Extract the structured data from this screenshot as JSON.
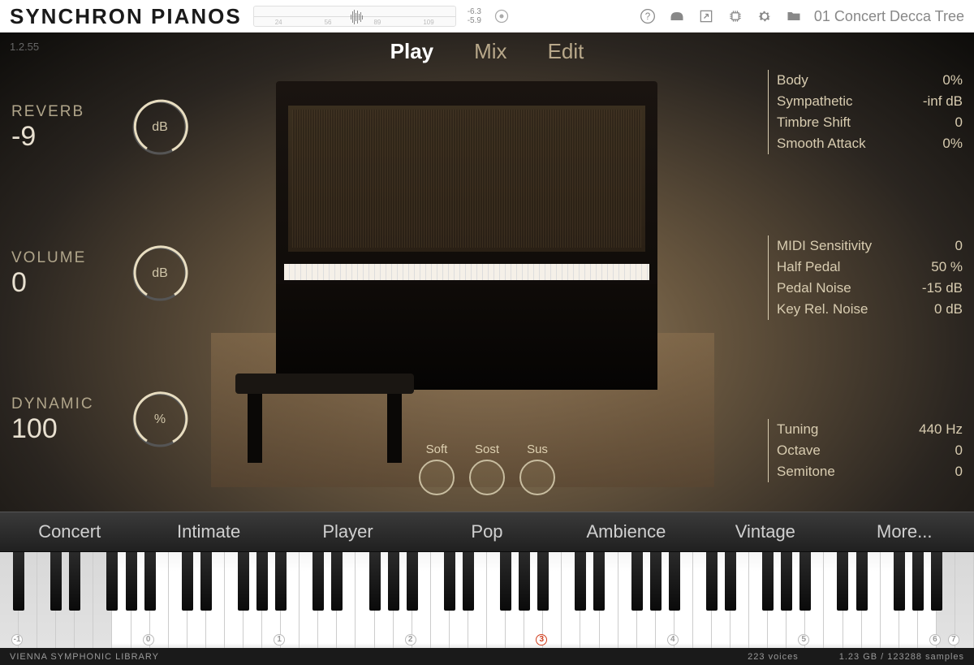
{
  "app_title": "SYNCHRON PIANOS",
  "version": "1.2.55",
  "meter": {
    "top": "-6.3",
    "bottom": "-5.9",
    "ticks": [
      "24",
      "56",
      "89",
      "109"
    ]
  },
  "preset": "01 Concert Decca Tree",
  "tabs": {
    "play": "Play",
    "mix": "Mix",
    "edit": "Edit"
  },
  "left": {
    "reverb": {
      "label": "REVERB",
      "value": "-9",
      "unit": "dB"
    },
    "volume": {
      "label": "VOLUME",
      "value": "0",
      "unit": "dB"
    },
    "dynamic": {
      "label": "DYNAMIC",
      "value": "100",
      "unit": "%"
    }
  },
  "right": {
    "g1": [
      {
        "label": "Body",
        "value": "0%"
      },
      {
        "label": "Sympathetic",
        "value": "-inf dB"
      },
      {
        "label": "Timbre Shift",
        "value": "0"
      },
      {
        "label": "Smooth Attack",
        "value": "0%"
      }
    ],
    "g2": [
      {
        "label": "MIDI Sensitivity",
        "value": "0"
      },
      {
        "label": "Half Pedal",
        "value": "50 %"
      },
      {
        "label": "Pedal Noise",
        "value": "-15 dB"
      },
      {
        "label": "Key Rel. Noise",
        "value": "0 dB"
      }
    ],
    "g3": [
      {
        "label": "Tuning",
        "value": "440 Hz"
      },
      {
        "label": "Octave",
        "value": "0"
      },
      {
        "label": "Semitone",
        "value": "0"
      }
    ]
  },
  "pedals": {
    "soft": "Soft",
    "sost": "Sost",
    "sus": "Sus"
  },
  "presets": [
    "Concert",
    "Intimate",
    "Player",
    "Pop",
    "Ambience",
    "Vintage",
    "More..."
  ],
  "octaves": [
    "-1",
    "0",
    "1",
    "2",
    "3",
    "4",
    "5",
    "6",
    "7"
  ],
  "footer": {
    "brand": "VIENNA SYMPHONIC LIBRARY",
    "voices": "223 voices",
    "samples": "1.23 GB / 123288 samples"
  }
}
